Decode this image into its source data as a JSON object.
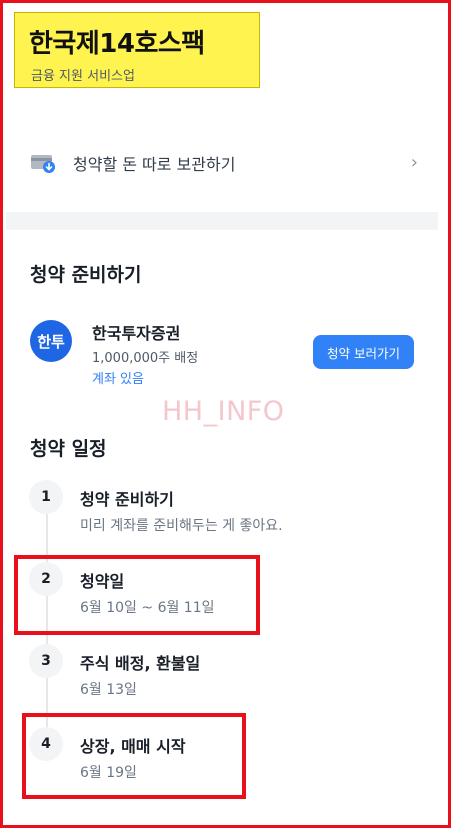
{
  "header": {
    "title": "한국제14호스팩",
    "subtitle": "금융 지원 서비스업"
  },
  "store_row": {
    "label": "청약할 돈 따로 보관하기",
    "icon": "wallet-download-icon"
  },
  "prepare": {
    "title": "청약 준비하기",
    "broker": {
      "logo_text": "한투",
      "name": "한국투자증권",
      "allocation": "1,000,000주 배정",
      "account_status": "계좌 있음",
      "button_label": "청약 보러가기"
    }
  },
  "watermark": "HH_INFO",
  "schedule": {
    "title": "청약 일정",
    "steps": [
      {
        "number": "1",
        "title": "청약 준비하기",
        "subtitle": "미리 계좌를 준비해두는 게 좋아요."
      },
      {
        "number": "2",
        "title": "청약일",
        "subtitle": "6월 10일 ~ 6월 11일"
      },
      {
        "number": "3",
        "title": "주식 배정, 환불일",
        "subtitle": "6월 13일"
      },
      {
        "number": "4",
        "title": "상장, 매매 시작",
        "subtitle": "6월 19일"
      }
    ]
  },
  "colors": {
    "accent": "#3182f6",
    "broker_logo": "#1f66e5",
    "highlight": "#e8101a",
    "header_bg": "#fff44f"
  }
}
